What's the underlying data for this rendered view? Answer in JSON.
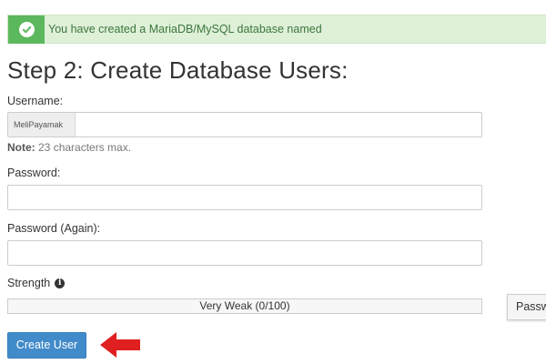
{
  "banner": {
    "message": "You have created a MariaDB/MySQL database named"
  },
  "page": {
    "title": "Step 2: Create Database Users:"
  },
  "form": {
    "username_label": "Username:",
    "username_prefix": "MeliPayamak",
    "username_value": "",
    "note_label": "Note:",
    "note_text": " 23 characters max.",
    "password_label": "Password:",
    "password_value": "",
    "password_again_label": "Password (Again):",
    "password_again_value": "",
    "strength_label": "Strength",
    "strength_text": "Very Weak (0/100)",
    "generator_label": "Passw"
  },
  "actions": {
    "create_label": "Create User"
  },
  "colors": {
    "success_bg": "#dff0d8",
    "success_accent": "#5cb85c",
    "primary": "#428bca",
    "arrow": "#e02020"
  },
  "icons": {
    "banner": "check-circle-icon",
    "strength_info": "info-icon",
    "annotation": "arrow-left-icon"
  }
}
